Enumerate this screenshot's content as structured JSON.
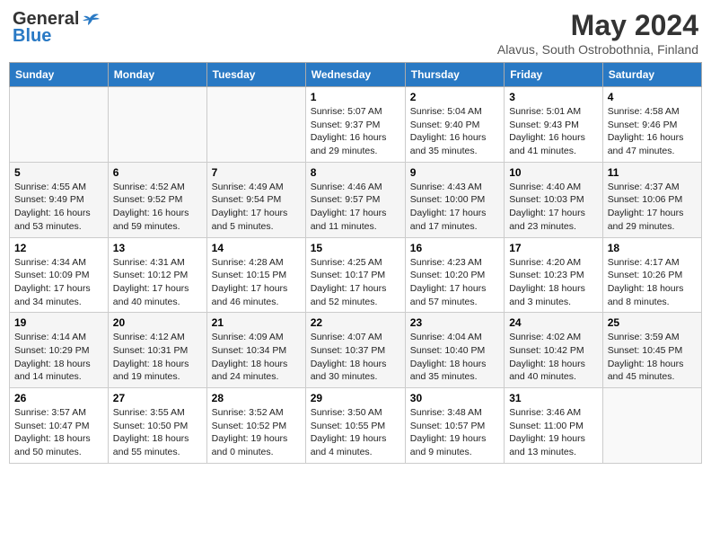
{
  "header": {
    "logo_general": "General",
    "logo_blue": "Blue",
    "month_title": "May 2024",
    "location": "Alavus, South Ostrobothnia, Finland"
  },
  "weekdays": [
    "Sunday",
    "Monday",
    "Tuesday",
    "Wednesday",
    "Thursday",
    "Friday",
    "Saturday"
  ],
  "weeks": [
    [
      {
        "day": "",
        "info": ""
      },
      {
        "day": "",
        "info": ""
      },
      {
        "day": "",
        "info": ""
      },
      {
        "day": "1",
        "info": "Sunrise: 5:07 AM\nSunset: 9:37 PM\nDaylight: 16 hours\nand 29 minutes."
      },
      {
        "day": "2",
        "info": "Sunrise: 5:04 AM\nSunset: 9:40 PM\nDaylight: 16 hours\nand 35 minutes."
      },
      {
        "day": "3",
        "info": "Sunrise: 5:01 AM\nSunset: 9:43 PM\nDaylight: 16 hours\nand 41 minutes."
      },
      {
        "day": "4",
        "info": "Sunrise: 4:58 AM\nSunset: 9:46 PM\nDaylight: 16 hours\nand 47 minutes."
      }
    ],
    [
      {
        "day": "5",
        "info": "Sunrise: 4:55 AM\nSunset: 9:49 PM\nDaylight: 16 hours\nand 53 minutes."
      },
      {
        "day": "6",
        "info": "Sunrise: 4:52 AM\nSunset: 9:52 PM\nDaylight: 16 hours\nand 59 minutes."
      },
      {
        "day": "7",
        "info": "Sunrise: 4:49 AM\nSunset: 9:54 PM\nDaylight: 17 hours\nand 5 minutes."
      },
      {
        "day": "8",
        "info": "Sunrise: 4:46 AM\nSunset: 9:57 PM\nDaylight: 17 hours\nand 11 minutes."
      },
      {
        "day": "9",
        "info": "Sunrise: 4:43 AM\nSunset: 10:00 PM\nDaylight: 17 hours\nand 17 minutes."
      },
      {
        "day": "10",
        "info": "Sunrise: 4:40 AM\nSunset: 10:03 PM\nDaylight: 17 hours\nand 23 minutes."
      },
      {
        "day": "11",
        "info": "Sunrise: 4:37 AM\nSunset: 10:06 PM\nDaylight: 17 hours\nand 29 minutes."
      }
    ],
    [
      {
        "day": "12",
        "info": "Sunrise: 4:34 AM\nSunset: 10:09 PM\nDaylight: 17 hours\nand 34 minutes."
      },
      {
        "day": "13",
        "info": "Sunrise: 4:31 AM\nSunset: 10:12 PM\nDaylight: 17 hours\nand 40 minutes."
      },
      {
        "day": "14",
        "info": "Sunrise: 4:28 AM\nSunset: 10:15 PM\nDaylight: 17 hours\nand 46 minutes."
      },
      {
        "day": "15",
        "info": "Sunrise: 4:25 AM\nSunset: 10:17 PM\nDaylight: 17 hours\nand 52 minutes."
      },
      {
        "day": "16",
        "info": "Sunrise: 4:23 AM\nSunset: 10:20 PM\nDaylight: 17 hours\nand 57 minutes."
      },
      {
        "day": "17",
        "info": "Sunrise: 4:20 AM\nSunset: 10:23 PM\nDaylight: 18 hours\nand 3 minutes."
      },
      {
        "day": "18",
        "info": "Sunrise: 4:17 AM\nSunset: 10:26 PM\nDaylight: 18 hours\nand 8 minutes."
      }
    ],
    [
      {
        "day": "19",
        "info": "Sunrise: 4:14 AM\nSunset: 10:29 PM\nDaylight: 18 hours\nand 14 minutes."
      },
      {
        "day": "20",
        "info": "Sunrise: 4:12 AM\nSunset: 10:31 PM\nDaylight: 18 hours\nand 19 minutes."
      },
      {
        "day": "21",
        "info": "Sunrise: 4:09 AM\nSunset: 10:34 PM\nDaylight: 18 hours\nand 24 minutes."
      },
      {
        "day": "22",
        "info": "Sunrise: 4:07 AM\nSunset: 10:37 PM\nDaylight: 18 hours\nand 30 minutes."
      },
      {
        "day": "23",
        "info": "Sunrise: 4:04 AM\nSunset: 10:40 PM\nDaylight: 18 hours\nand 35 minutes."
      },
      {
        "day": "24",
        "info": "Sunrise: 4:02 AM\nSunset: 10:42 PM\nDaylight: 18 hours\nand 40 minutes."
      },
      {
        "day": "25",
        "info": "Sunrise: 3:59 AM\nSunset: 10:45 PM\nDaylight: 18 hours\nand 45 minutes."
      }
    ],
    [
      {
        "day": "26",
        "info": "Sunrise: 3:57 AM\nSunset: 10:47 PM\nDaylight: 18 hours\nand 50 minutes."
      },
      {
        "day": "27",
        "info": "Sunrise: 3:55 AM\nSunset: 10:50 PM\nDaylight: 18 hours\nand 55 minutes."
      },
      {
        "day": "28",
        "info": "Sunrise: 3:52 AM\nSunset: 10:52 PM\nDaylight: 19 hours\nand 0 minutes."
      },
      {
        "day": "29",
        "info": "Sunrise: 3:50 AM\nSunset: 10:55 PM\nDaylight: 19 hours\nand 4 minutes."
      },
      {
        "day": "30",
        "info": "Sunrise: 3:48 AM\nSunset: 10:57 PM\nDaylight: 19 hours\nand 9 minutes."
      },
      {
        "day": "31",
        "info": "Sunrise: 3:46 AM\nSunset: 11:00 PM\nDaylight: 19 hours\nand 13 minutes."
      },
      {
        "day": "",
        "info": ""
      }
    ]
  ]
}
